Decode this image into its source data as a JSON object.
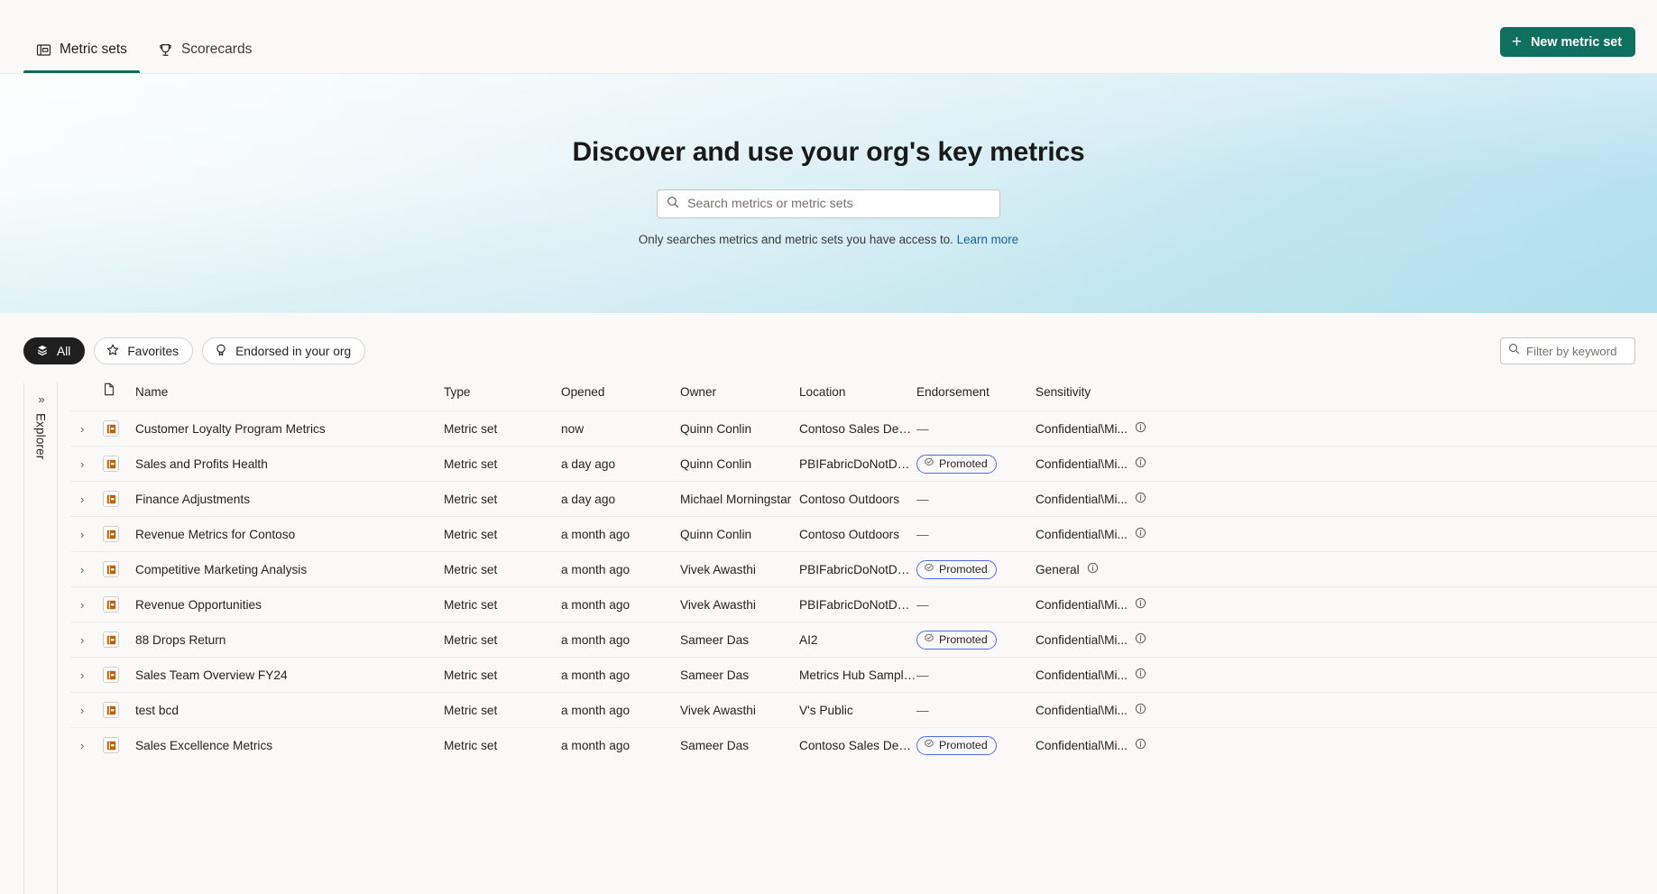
{
  "topbar": {
    "tabs": [
      {
        "label": "Metric sets",
        "icon": "metric-set-icon",
        "active": true
      },
      {
        "label": "Scorecards",
        "icon": "trophy-icon",
        "active": false
      }
    ],
    "new_button": {
      "label": "New metric set",
      "plus": "+",
      "color": "#0f705f"
    }
  },
  "hero": {
    "title": "Discover and use your org's key metrics",
    "search_placeholder": "Search metrics or metric sets",
    "search_value": "",
    "note": "Only searches metrics and metric sets you have access to.",
    "note_link": "Learn more"
  },
  "filters": {
    "pills": [
      {
        "label": "All",
        "icon": "stack-icon",
        "active": true
      },
      {
        "label": "Favorites",
        "icon": "star-icon",
        "active": false
      },
      {
        "label": "Endorsed in your org",
        "icon": "endorsement-badge-icon",
        "active": false
      }
    ],
    "keyword_placeholder": "Filter by keyword",
    "keyword_value": ""
  },
  "explorer": {
    "label": "Explorer",
    "expand_icon": "chevron-double-right-icon"
  },
  "table": {
    "columns": [
      "Name",
      "Type",
      "Opened",
      "Owner",
      "Location",
      "Endorsement",
      "Sensitivity"
    ],
    "rows": [
      {
        "name": "Customer Loyalty Program Metrics",
        "type": "Metric set",
        "opened": "now",
        "owner": "Quinn Conlin",
        "location": "Contoso Sales Dem...",
        "endorsement": "—",
        "promoted": false,
        "sensitivity": "Confidential\\Mi..."
      },
      {
        "name": "Sales and Profits Health",
        "type": "Metric set",
        "opened": "a day ago",
        "owner": "Quinn Conlin",
        "location": "PBIFabricDoNotDelete",
        "endorsement": "Promoted",
        "promoted": true,
        "sensitivity": "Confidential\\Mi..."
      },
      {
        "name": "Finance Adjustments",
        "type": "Metric set",
        "opened": "a day ago",
        "owner": "Michael Morningstar",
        "location": "Contoso Outdoors",
        "endorsement": "—",
        "promoted": false,
        "sensitivity": "Confidential\\Mi..."
      },
      {
        "name": "Revenue Metrics for Contoso",
        "type": "Metric set",
        "opened": "a month ago",
        "owner": "Quinn Conlin",
        "location": "Contoso Outdoors",
        "endorsement": "—",
        "promoted": false,
        "sensitivity": "Confidential\\Mi..."
      },
      {
        "name": "Competitive Marketing Analysis",
        "type": "Metric set",
        "opened": "a month ago",
        "owner": "Vivek Awasthi",
        "location": "PBIFabricDoNotDelete",
        "endorsement": "Promoted",
        "promoted": true,
        "sensitivity": "General"
      },
      {
        "name": "Revenue Opportunities",
        "type": "Metric set",
        "opened": "a month ago",
        "owner": "Vivek Awasthi",
        "location": "PBIFabricDoNotDelete",
        "endorsement": "—",
        "promoted": false,
        "sensitivity": "Confidential\\Mi..."
      },
      {
        "name": "88 Drops Return",
        "type": "Metric set",
        "opened": "a month ago",
        "owner": "Sameer Das",
        "location": "AI2",
        "endorsement": "Promoted",
        "promoted": true,
        "sensitivity": "Confidential\\Mi..."
      },
      {
        "name": "Sales Team Overview FY24",
        "type": "Metric set",
        "opened": "a month ago",
        "owner": "Sameer Das",
        "location": "Metrics Hub Samples",
        "endorsement": "—",
        "promoted": false,
        "sensitivity": "Confidential\\Mi..."
      },
      {
        "name": "test bcd",
        "type": "Metric set",
        "opened": "a month ago",
        "owner": "Vivek Awasthi",
        "location": "V's Public",
        "endorsement": "—",
        "promoted": false,
        "sensitivity": "Confidential\\Mi..."
      },
      {
        "name": "Sales Excellence Metrics",
        "type": "Metric set",
        "opened": "a month ago",
        "owner": "Sameer Das",
        "location": "Contoso Sales Dem...",
        "endorsement": "Promoted",
        "promoted": true,
        "sensitivity": "Confidential\\Mi..."
      }
    ]
  },
  "colors": {
    "accent_green": "#0f705f",
    "endorsement_blue": "#4f6bed",
    "metric_icon_orange": "#c06000",
    "link_blue": "#1264a3"
  }
}
